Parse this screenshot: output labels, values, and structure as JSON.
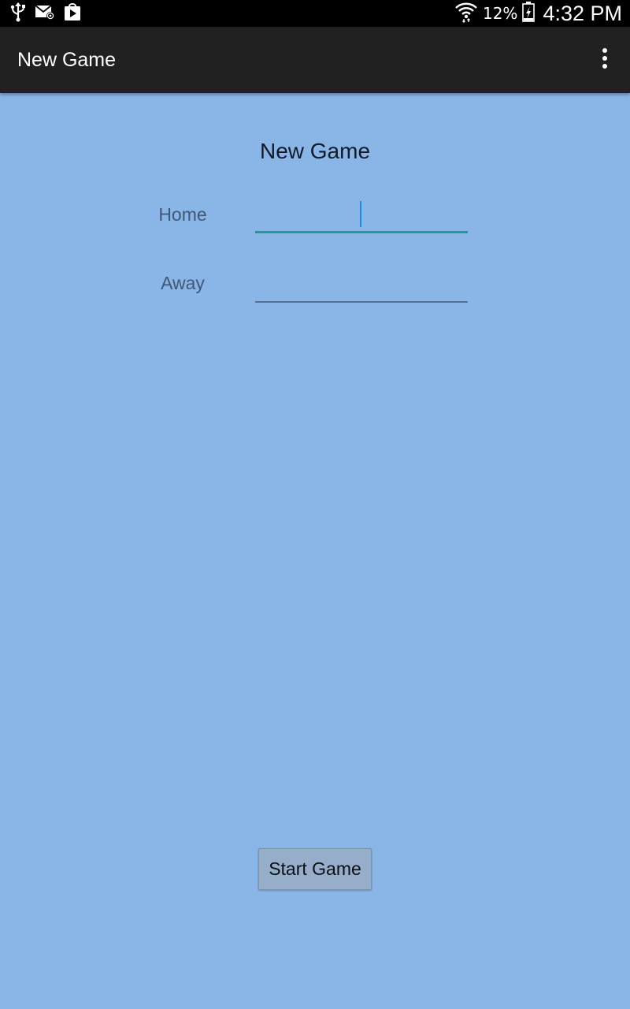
{
  "status_bar": {
    "icons": [
      "usb-icon",
      "email-icon",
      "play-store-icon",
      "wifi-icon",
      "battery-charging-icon"
    ],
    "battery_percent": "12%",
    "time": "4:32 PM"
  },
  "action_bar": {
    "title": "New Game",
    "overflow_icon": "overflow-menu-icon"
  },
  "form": {
    "title": "New Game",
    "home_label": "Home",
    "home_value": "",
    "away_label": "Away",
    "away_value": ""
  },
  "start_button_label": "Start Game",
  "colors": {
    "background": "#8ab6e7",
    "action_bar": "#212121",
    "status_bar": "#000000",
    "focused_underline": "#1f9a9a",
    "caret": "#1e88e5",
    "button": "#96aec9"
  }
}
